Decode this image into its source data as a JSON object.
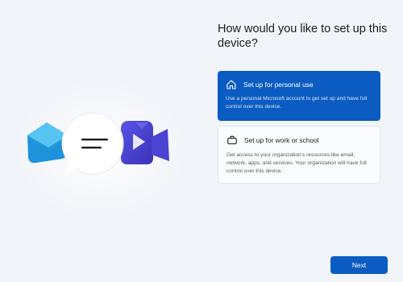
{
  "heading": "How would you like to set up this device?",
  "options": [
    {
      "icon": "home-icon",
      "title": "Set up for personal use",
      "description": "Use a personal Microsoft account to get set up and have full control over this device.",
      "selected": true
    },
    {
      "icon": "briefcase-icon",
      "title": "Set up for work or school",
      "description": "Get access to your organization's resources like email, network, apps, and services. Your organization will have full control over this device.",
      "selected": false
    }
  ],
  "next_label": "Next",
  "colors": {
    "accent": "#0b5cc2",
    "background": "#f1f4f9"
  },
  "illustration": [
    "mail-icon",
    "chat-bubble-icon",
    "video-camera-icon"
  ]
}
